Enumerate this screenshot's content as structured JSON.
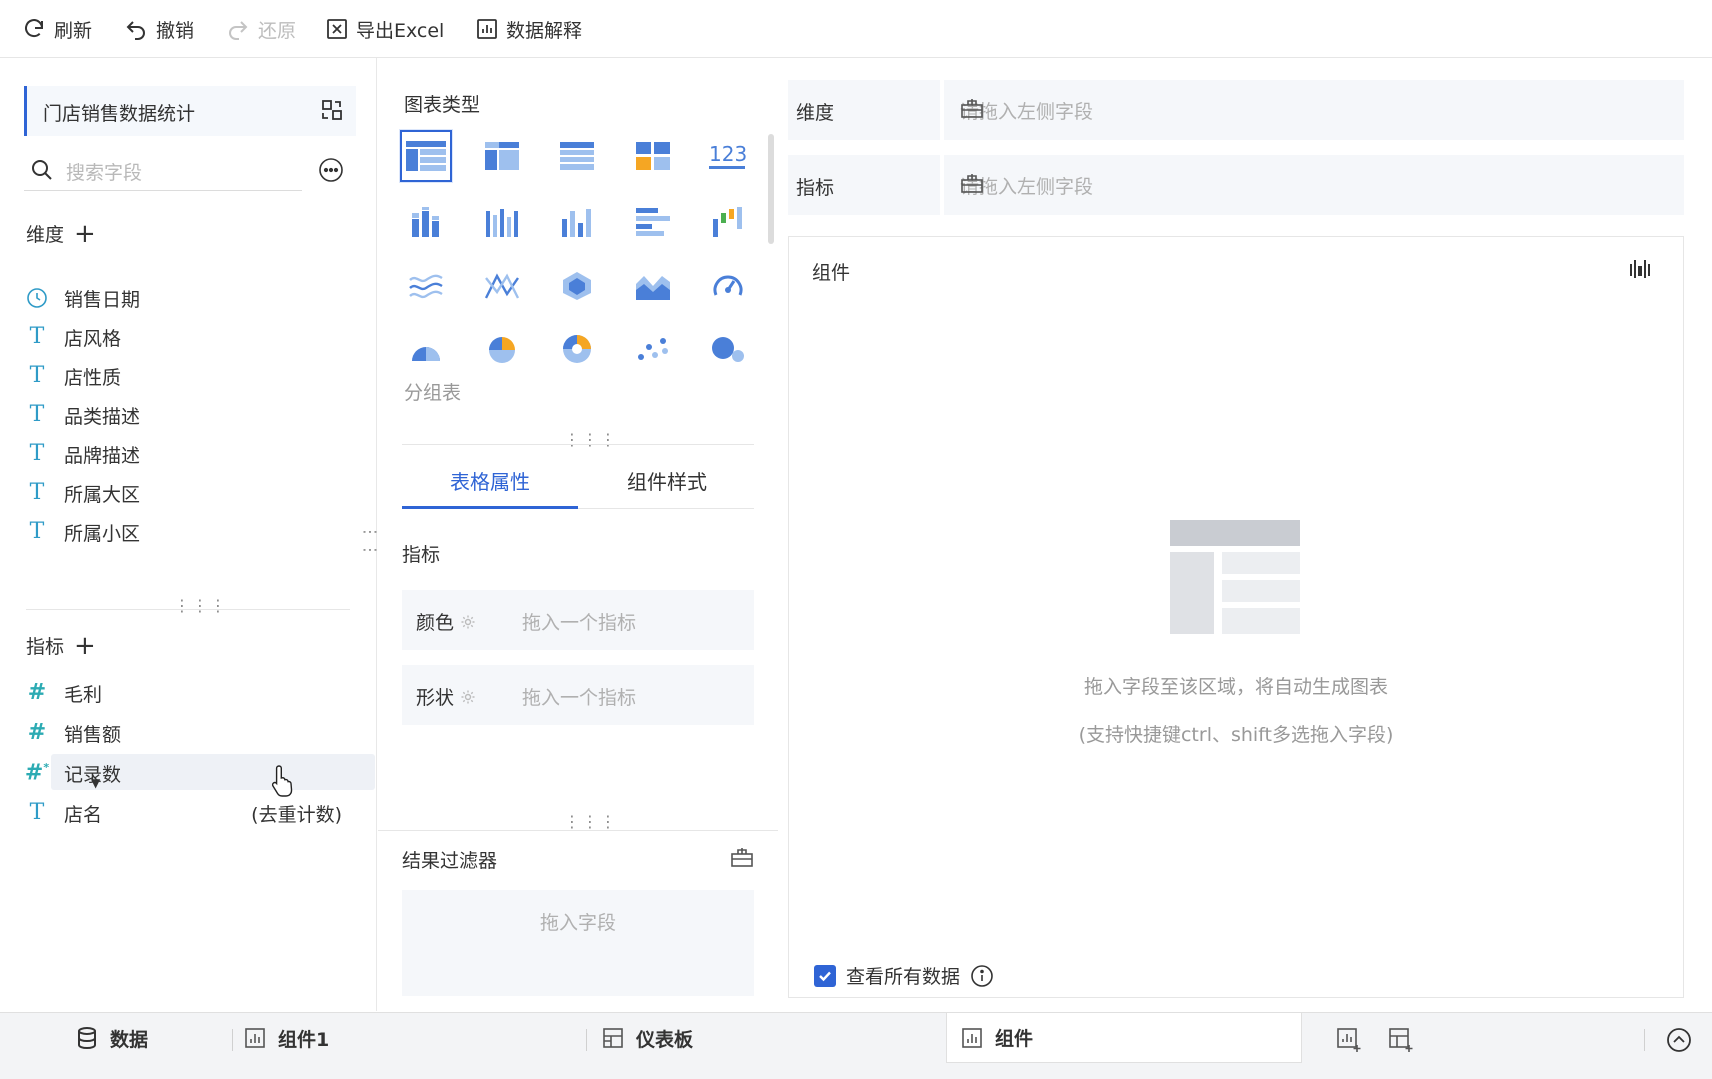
{
  "toolbar": {
    "refresh": "刷新",
    "undo": "撤销",
    "redo": "还原",
    "export": "导出Excel",
    "explain": "数据解释"
  },
  "left": {
    "dataset": "门店销售数据统计",
    "search_placeholder": "搜索字段",
    "dim_title": "维度",
    "dimensions": [
      {
        "label": "销售日期",
        "type": "date"
      },
      {
        "label": "店风格",
        "type": "text"
      },
      {
        "label": "店性质",
        "type": "text"
      },
      {
        "label": "品类描述",
        "type": "text"
      },
      {
        "label": "品牌描述",
        "type": "text"
      },
      {
        "label": "所属大区",
        "type": "text"
      },
      {
        "label": "所属小区",
        "type": "text"
      }
    ],
    "metric_title": "指标",
    "metrics": [
      {
        "label": "毛利",
        "type": "number"
      },
      {
        "label": "销售额",
        "type": "number"
      },
      {
        "label": "记录数",
        "type": "number-star"
      },
      {
        "label": "店名",
        "type": "text",
        "note": "(去重计数)"
      }
    ]
  },
  "middle": {
    "chart_types_title": "图表类型",
    "selected_chart_name": "分组表",
    "tabs": [
      "表格属性",
      "组件样式"
    ],
    "metric_label": "指标",
    "props": [
      {
        "label": "颜色",
        "placeholder": "拖入一个指标"
      },
      {
        "label": "形状",
        "placeholder": "拖入一个指标"
      }
    ],
    "filter_title": "结果过滤器",
    "filter_placeholder": "拖入字段"
  },
  "right": {
    "dimension_label": "维度",
    "dimension_placeholder": "请拖入左侧字段",
    "metric_label": "指标",
    "metric_placeholder": "请拖入左侧字段",
    "canvas_title": "组件",
    "empty_line1": "拖入字段至该区域，将自动生成图表",
    "empty_line2": "(支持快捷键ctrl、shift多选拖入字段)",
    "show_all_label": "查看所有数据",
    "show_all_checked": true
  },
  "bottom": {
    "data_tab": "数据",
    "widget1_tab": "组件1",
    "dashboard_tab": "仪表板",
    "component_tab": "组件"
  },
  "colors": {
    "accent": "#2f64d5",
    "icon_blue": "#4a7fd8",
    "icon_light": "#9ec0ee",
    "field_teal": "#2cabb3"
  }
}
